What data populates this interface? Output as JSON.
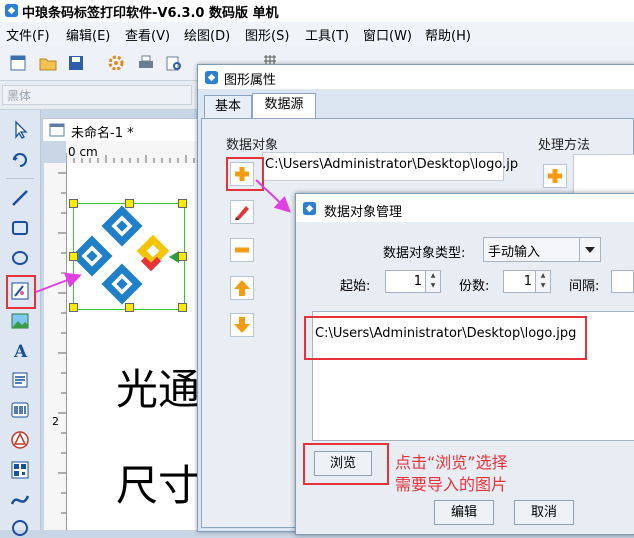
{
  "app": {
    "title": "中琅条码标签打印软件-V6.3.0 数码版 单机"
  },
  "menu": {
    "items": [
      "文件(F)",
      "编辑(E)",
      "查看(V)",
      "绘图(D)",
      "图形(S)",
      "工具(T)",
      "窗口(W)",
      "帮助(H)"
    ]
  },
  "font_bar": {
    "font_value": "黑体"
  },
  "document": {
    "tab_label": "未命名-1 *",
    "ruler_label": "0 cm",
    "ruler_v_label": "2",
    "text_line1": "光通",
    "text_line2": "尺寸"
  },
  "shape_dialog": {
    "title": "图形属性",
    "tabs": [
      "基本",
      "数据源"
    ],
    "active_tab": "数据源",
    "data_object_label": "数据对象",
    "process_label": "处理方法",
    "source_path": "C:\\Users\\Administrator\\Desktop\\logo.jp"
  },
  "data_manager": {
    "title": "数据对象管理",
    "type_label": "数据对象类型:",
    "type_value": "手动输入",
    "start_label": "起始:",
    "start_value": "1",
    "copies_label": "份数:",
    "copies_value": "1",
    "interval_label": "间隔:",
    "content": "C:\\Users\\Administrator\\Desktop\\logo.jpg",
    "browse_label": "浏览",
    "edit_label": "编辑",
    "cancel_label": "取消"
  },
  "annotation": {
    "line1": "点击“浏览”选择",
    "line2": "需要导入的图片"
  },
  "colors": {
    "highlight_red": "#e8323a",
    "arrow_magenta": "#e040e0",
    "selection_green": "#33cc33",
    "handle_yellow": "#ffea00"
  }
}
